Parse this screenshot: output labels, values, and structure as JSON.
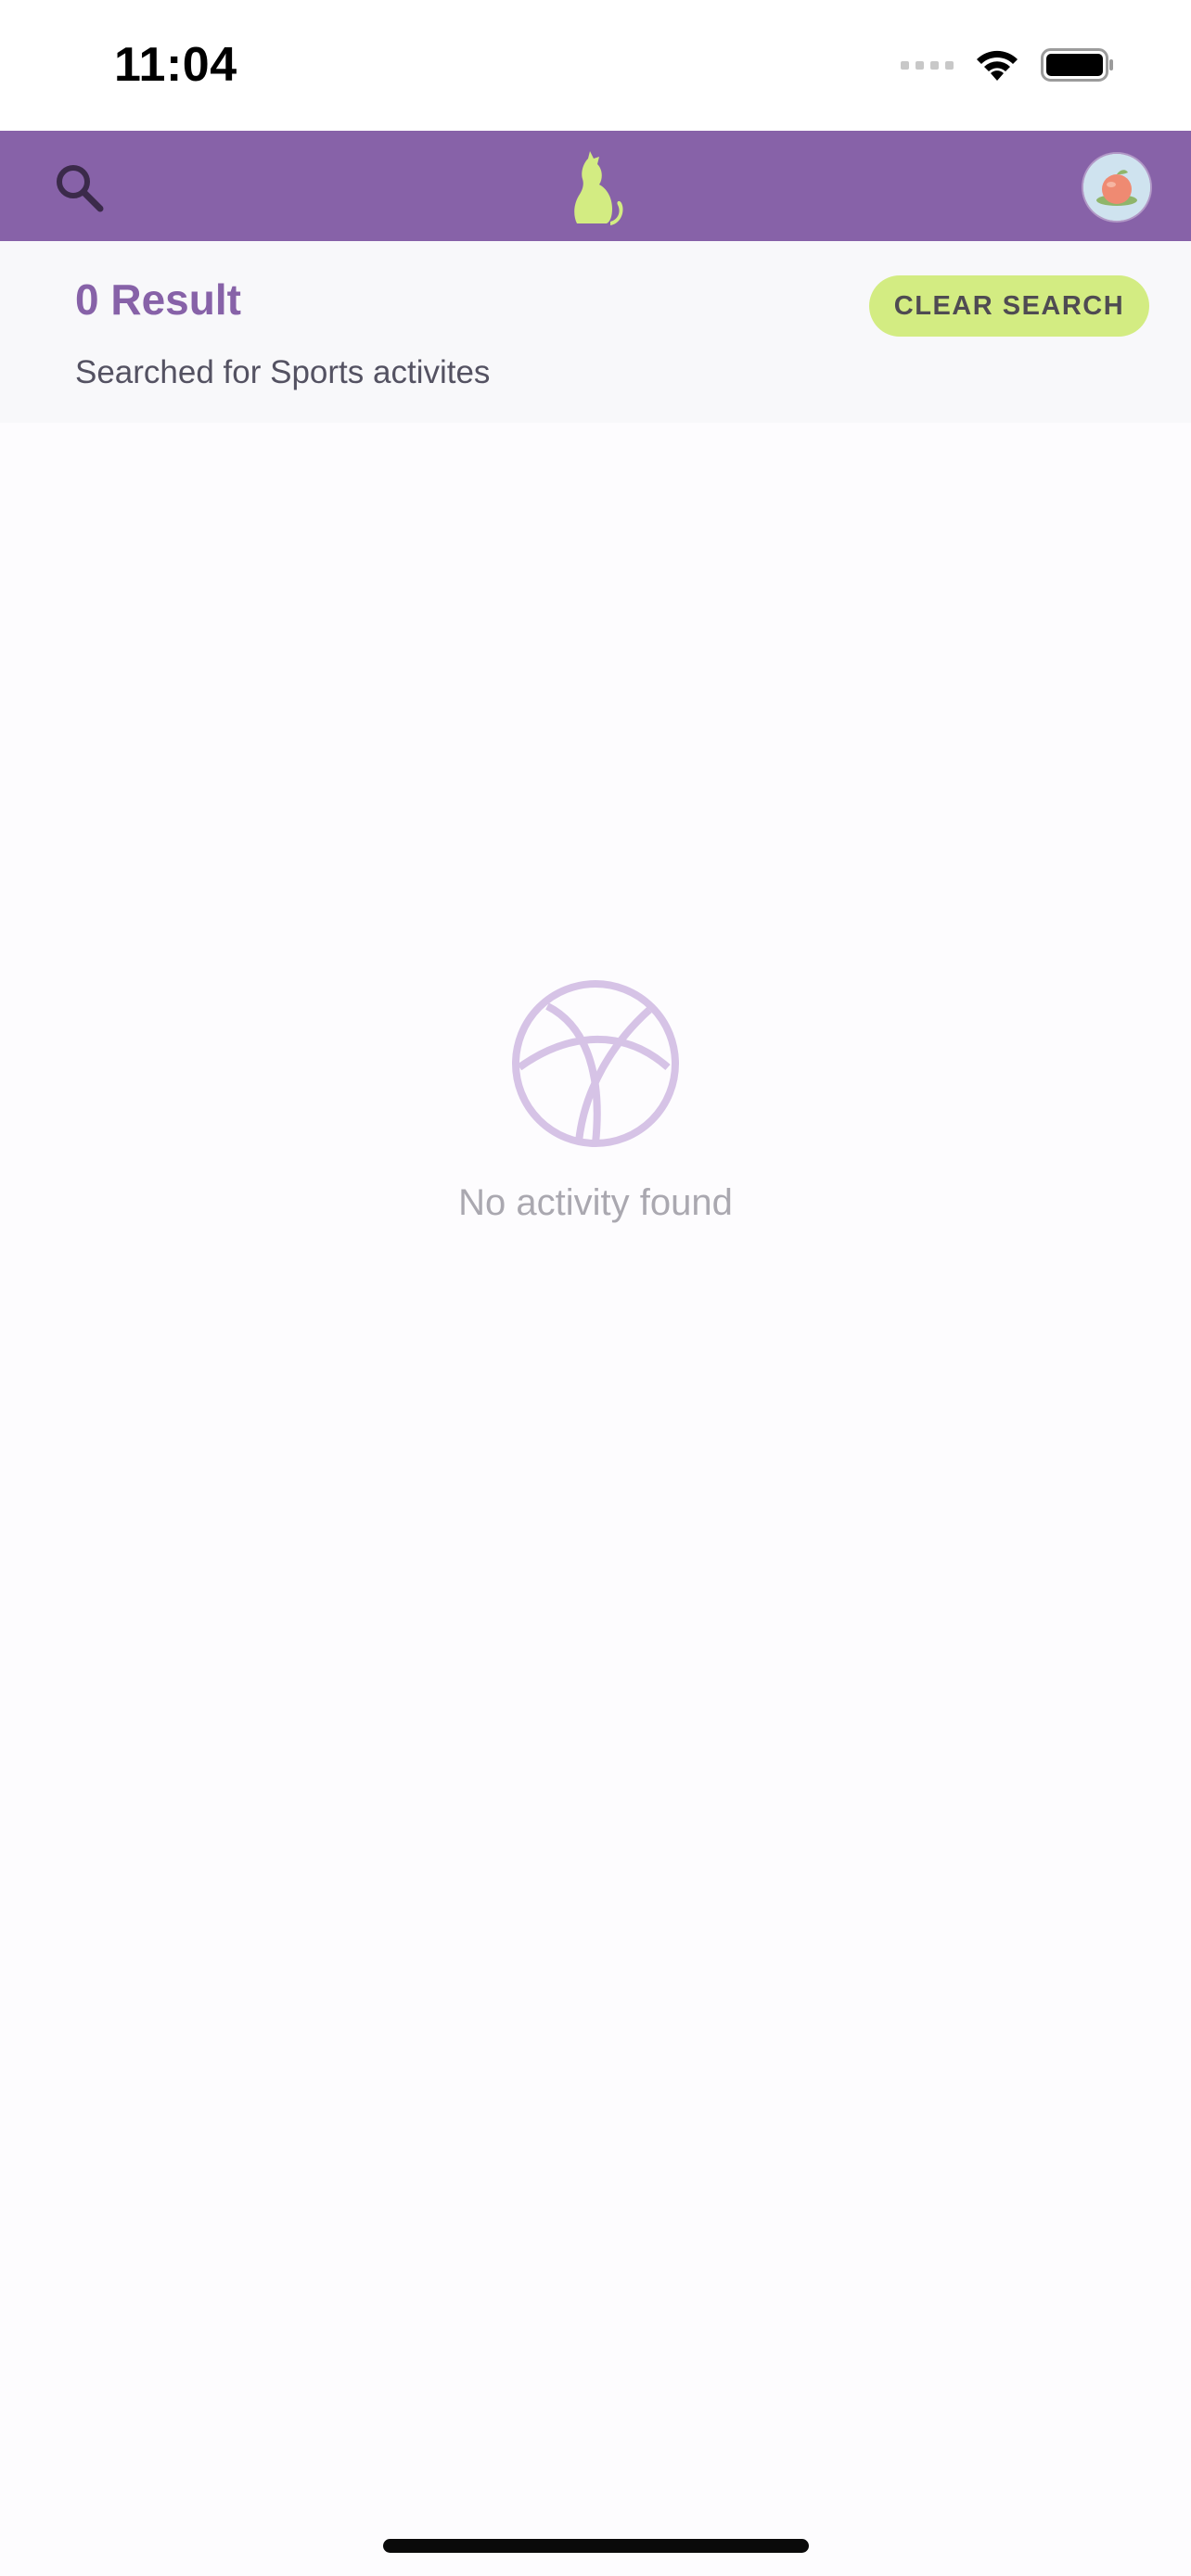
{
  "status_bar": {
    "time": "11:04"
  },
  "app_bar": {
    "search_icon": "search-icon",
    "logo_icon": "cat-logo-icon",
    "avatar_icon": "avatar-icon",
    "background_color": "#8762a8",
    "logo_color": "#d3ec82"
  },
  "results": {
    "count_label": "0 Result",
    "subtitle": "Searched for Sports activites",
    "clear_button_label": "CLEAR SEARCH",
    "accent_color": "#8762a8",
    "button_color": "#d3ec82"
  },
  "empty_state": {
    "icon": "basketball-icon",
    "message": "No activity found",
    "icon_color": "#d6c3e6"
  }
}
